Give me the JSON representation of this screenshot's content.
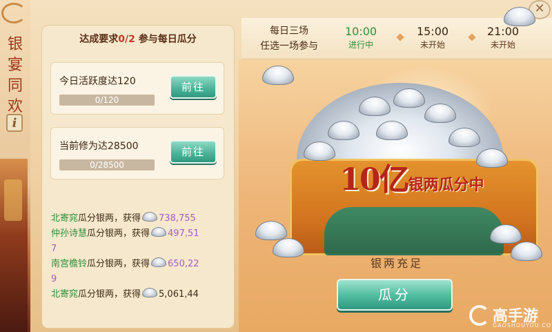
{
  "sidebar": {
    "title_chars": [
      "银",
      "宴",
      "同",
      "欢"
    ],
    "info_label": "i"
  },
  "requirement": {
    "prefix": "达成要求",
    "progress": "0/2",
    "suffix": "参与每日瓜分"
  },
  "tasks": [
    {
      "title": "今日活跃度达120",
      "progress_text": "0/120",
      "progress_fraction": 0,
      "button": "前往"
    },
    {
      "title": "当前修为达28500",
      "progress_text": "0/28500",
      "progress_fraction": 0,
      "button": "前往"
    }
  ],
  "feed": [
    {
      "player": "北寄窕",
      "action": "瓜分银两，获得",
      "amount_line1": "738,755",
      "amount_line2": ""
    },
    {
      "player": "仲孙诗慧",
      "action": "瓜分银两，获得",
      "amount_line1": "497,51",
      "amount_line2": "7"
    },
    {
      "player": "南宫檐铃",
      "action": "瓜分银两，获得",
      "amount_line1": "650,22",
      "amount_line2": "9"
    },
    {
      "player": "北寄窕",
      "action": "瓜分银两，获得",
      "amount_line1": "5,061,44",
      "amount_line2": ""
    }
  ],
  "schedule": {
    "desc_line1": "每日三场",
    "desc_line2": "任选一场参与",
    "slots": [
      {
        "time": "10:00",
        "status": "进行中"
      },
      {
        "time": "15:00",
        "status": "未开始"
      },
      {
        "time": "21:00",
        "status": "未开始"
      }
    ]
  },
  "banner": {
    "number": "10亿",
    "text": "银两瓜分中",
    "subtitle": "银两充足",
    "action_button": "瓜分"
  },
  "close_label": "✕",
  "watermark": {
    "text": "高手游",
    "sub": "GAOSHOUYOU.COM"
  },
  "colors": {
    "active_green": "#2e8d3a",
    "amount_purple": "#a55cc9",
    "banner_red": "#b5251a"
  }
}
